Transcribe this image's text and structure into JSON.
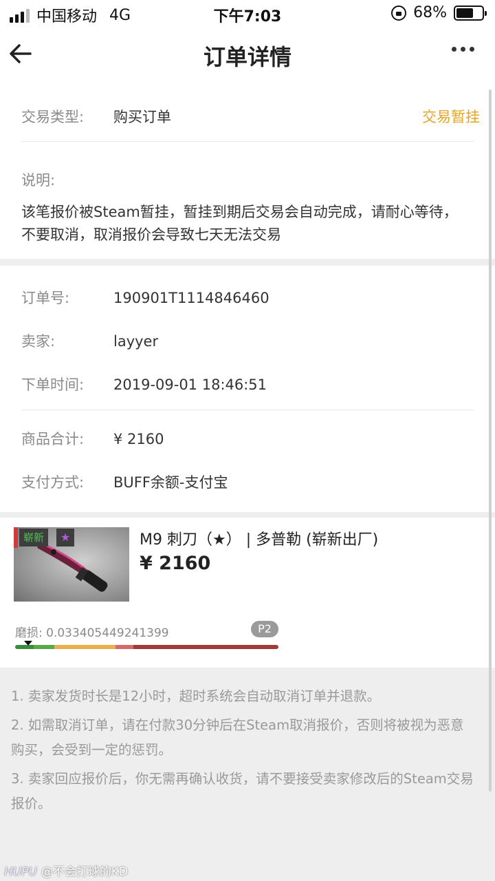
{
  "status_bar": {
    "carrier": "中国移动",
    "network": "4G",
    "time": "下午7:03",
    "battery": "68%",
    "battery_level": 0.68
  },
  "nav": {
    "title": "订单详情",
    "back_icon": "back-arrow-icon",
    "more_icon": "more-dots-icon"
  },
  "trade": {
    "type_label": "交易类型:",
    "type_value": "购买订单",
    "status": "交易暂挂",
    "status_color": "#e6a425",
    "desc_label": "说明:",
    "desc_text": "该笔报价被Steam暂挂，暂挂到期后交易会自动完成，请耐心等待，不要取消，取消报价会导致七天无法交易"
  },
  "order": {
    "id_label": "订单号:",
    "id_value": "190901T1114846460",
    "seller_label": "卖家:",
    "seller_value": "layyer",
    "time_label": "下单时间:",
    "time_value": "2019-09-01 18:46:51",
    "total_label": "商品合计:",
    "total_value": "¥ 2160",
    "payment_label": "支付方式:",
    "payment_value": "BUFF余额-支付宝"
  },
  "item": {
    "tag_new": "崭新",
    "tag_star": "★",
    "name": "M9 刺刀（★） | 多普勒 (崭新出厂)",
    "price": "¥ 2160",
    "wear_label": "磨损: 0.033405449241399",
    "wear_value": 0.033405449241399,
    "phase": "P2",
    "wear_segments": [
      {
        "color": "#3d8b3d",
        "share": 0.07
      },
      {
        "color": "#5aa84a",
        "share": 0.08
      },
      {
        "color": "#e8b04a",
        "share": 0.23
      },
      {
        "color": "#d46a6a",
        "share": 0.07
      },
      {
        "color": "#a33a3a",
        "share": 0.55
      }
    ]
  },
  "notes": [
    "1. 卖家发货时长是12小时，超时系统会自动取消订单并退款。",
    "2. 如需取消订单，请在付款30分钟后在Steam取消报价，否则将被视为恶意购买，会受到一定的惩罚。",
    "3. 卖家回应报价后，你无需再确认收货，请不要接受卖家修改后的Steam交易报价。"
  ],
  "watermark": {
    "brand": "HUPU",
    "user": "@不会打球的KD"
  }
}
